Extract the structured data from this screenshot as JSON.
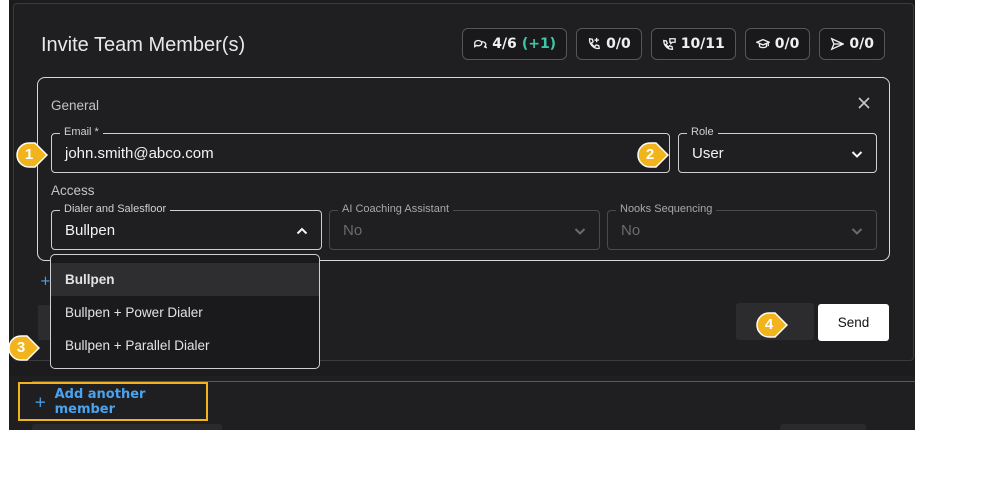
{
  "modal": {
    "title": "Invite Team Member(s)",
    "badges": [
      {
        "icon": "chat-bubbles-icon",
        "value": "4/6",
        "extra": "(+1)"
      },
      {
        "icon": "phone-plus-icon",
        "value": "0/0"
      },
      {
        "icon": "phone-chat-icon",
        "value": "10/11"
      },
      {
        "icon": "graduation-cap-icon",
        "value": "0/0"
      },
      {
        "icon": "send-icon",
        "value": "0/0"
      }
    ]
  },
  "general": {
    "label": "General",
    "email": {
      "label": "Email *",
      "value": "john.smith@abco.com"
    },
    "role": {
      "label": "Role",
      "value": "User"
    }
  },
  "access": {
    "label": "Access",
    "dialer": {
      "label": "Dialer and Salesfloor",
      "value": "Bullpen"
    },
    "coaching": {
      "label": "AI Coaching Assistant",
      "value": "No"
    },
    "sequencing": {
      "label": "Nooks Sequencing",
      "value": "No"
    }
  },
  "dropdown": {
    "options": [
      "Bullpen",
      "Bullpen + Power Dialer",
      "Bullpen + Parallel Dialer"
    ]
  },
  "actions": {
    "send_label": "Send",
    "add_plus": "+"
  },
  "background": {
    "add_member_label": "Add another member",
    "plus": "+"
  },
  "markers": [
    "1",
    "2",
    "3",
    "4"
  ],
  "colors": {
    "accent": "#f2b41c",
    "link": "#4aa3f0",
    "positive": "#3ec6a8"
  }
}
